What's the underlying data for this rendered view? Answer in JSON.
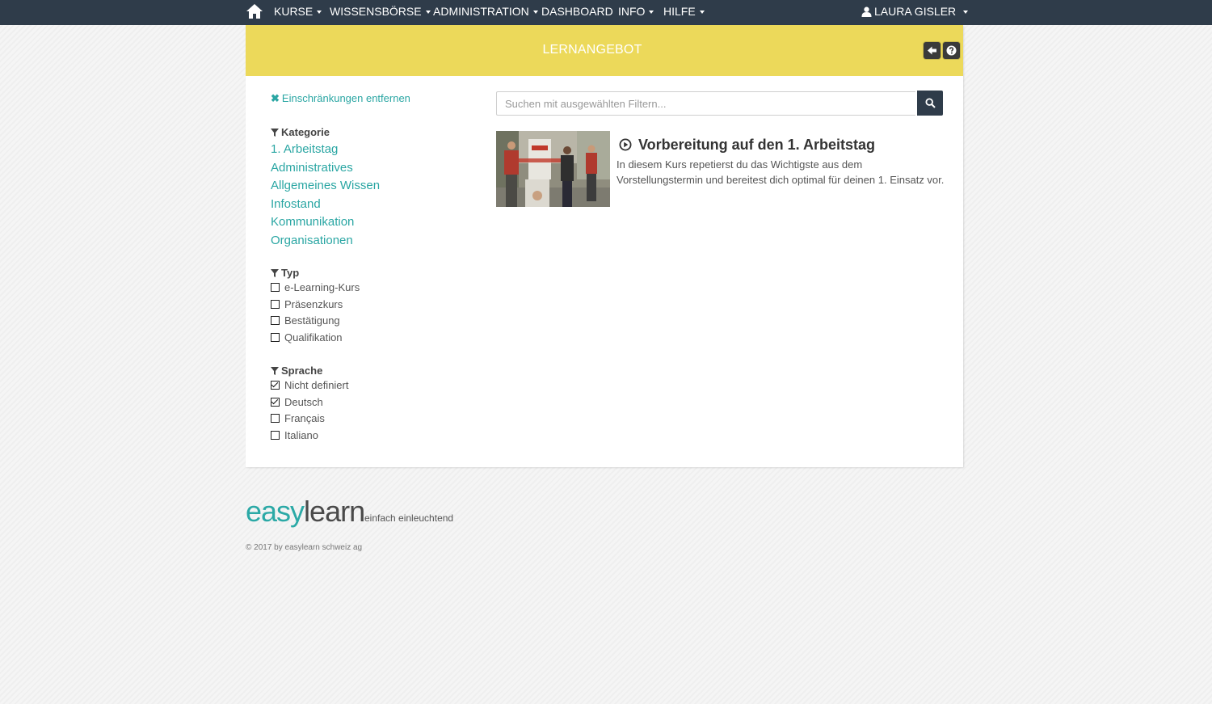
{
  "nav": {
    "items": [
      {
        "label": "KURSE",
        "dropdown": true
      },
      {
        "label": "WISSENSBÖRSE",
        "dropdown": true
      },
      {
        "label": "ADMINISTRATION",
        "dropdown": true
      },
      {
        "label": "DASHBOARD",
        "dropdown": false
      },
      {
        "label": "INFO",
        "dropdown": true
      },
      {
        "label": "HILFE",
        "dropdown": true
      }
    ],
    "user": "LAURA GISLER",
    "icons": {
      "home": "home-icon",
      "user": "user-icon"
    },
    "color": "#2f3c4a"
  },
  "panel": {
    "title": "LERNANGEBOT",
    "header_color": "#ecd95a",
    "buttons": [
      {
        "icon": "arrow-left-icon"
      },
      {
        "icon": "question-circle-icon"
      }
    ]
  },
  "filters": {
    "clear_label": "Einschränkungen entfernen",
    "category": {
      "heading": "Kategorie",
      "items": [
        "1. Arbeitstag",
        "Administratives",
        "Allgemeines Wissen",
        "Infostand",
        "Kommunikation",
        "Organisationen"
      ]
    },
    "type": {
      "heading": "Typ",
      "items": [
        {
          "label": "e-Learning-Kurs",
          "checked": false
        },
        {
          "label": "Präsenzkurs",
          "checked": false
        },
        {
          "label": "Bestätigung",
          "checked": false
        },
        {
          "label": "Qualifikation",
          "checked": false
        }
      ]
    },
    "language": {
      "heading": "Sprache",
      "items": [
        {
          "label": "Nicht definiert",
          "checked": true
        },
        {
          "label": "Deutsch",
          "checked": true
        },
        {
          "label": "Français",
          "checked": false
        },
        {
          "label": "Italiano",
          "checked": false
        }
      ]
    },
    "link_color": "#2aa6a3"
  },
  "search": {
    "placeholder": "Suchen mit ausgewählten Filtern...",
    "value": ""
  },
  "course": {
    "title": "Vorbereitung auf den 1. Arbeitstag",
    "description": "In diesem Kurs repetierst du das Wichtigste aus dem Vorstellungstermin und bereitest dich optimal für deinen 1. Einsatz vor."
  },
  "footer": {
    "logo_part1": "easy",
    "logo_part2": "learn",
    "tagline": "einfach einleuchtend",
    "copyright": "© 2017 by easylearn schweiz ag"
  }
}
